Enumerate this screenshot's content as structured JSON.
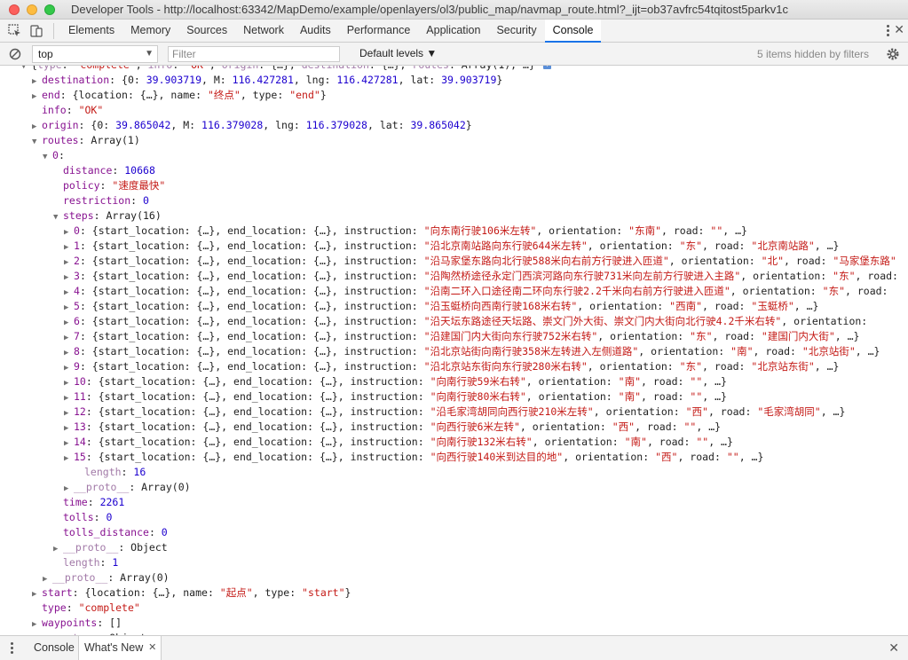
{
  "window": {
    "title": "Developer Tools - http://localhost:63342/MapDemo/example/openlayers/ol3/public_map/navmap_route.html?_ijt=ob37avfrc54tqitost5parkv1c"
  },
  "tabs": [
    "Elements",
    "Memory",
    "Sources",
    "Network",
    "Audits",
    "Performance",
    "Application",
    "Security",
    "Console"
  ],
  "active_tab": "Console",
  "console_toolbar": {
    "context": "top",
    "filter_placeholder": "Filter",
    "levels": "Default levels ▼",
    "hidden_msg": "5 items hidden by filters"
  },
  "lines": [
    {
      "indent": 1,
      "tri": "▼",
      "parts": [
        [
          "p",
          "{"
        ],
        [
          "k dim",
          "type"
        ],
        [
          "p",
          ": "
        ],
        [
          "s",
          "\"complete\""
        ],
        [
          "p",
          ", "
        ],
        [
          "k dim",
          "info"
        ],
        [
          "p",
          ": "
        ],
        [
          "s",
          "\"OK\""
        ],
        [
          "p",
          ", "
        ],
        [
          "k dim",
          "origin"
        ],
        [
          "p",
          ": {…}, "
        ],
        [
          "k dim",
          "destination"
        ],
        [
          "p",
          ": {…}, "
        ],
        [
          "k dim",
          "routes"
        ],
        [
          "p",
          ": Array(1), …} "
        ]
      ]
    },
    {
      "indent": 2,
      "tri": "▶",
      "parts": [
        [
          "k",
          "destination"
        ],
        [
          "p",
          ": {0: "
        ],
        [
          "n",
          "39.903719"
        ],
        [
          "p",
          ", M: "
        ],
        [
          "n",
          "116.427281"
        ],
        [
          "p",
          ", lng: "
        ],
        [
          "n",
          "116.427281"
        ],
        [
          "p",
          ", lat: "
        ],
        [
          "n",
          "39.903719"
        ],
        [
          "p",
          "}"
        ]
      ]
    },
    {
      "indent": 2,
      "tri": "▶",
      "parts": [
        [
          "k",
          "end"
        ],
        [
          "p",
          ": {location: {…}, name: "
        ],
        [
          "s",
          "\"终点\""
        ],
        [
          "p",
          ", type: "
        ],
        [
          "s",
          "\"end\""
        ],
        [
          "p",
          "}"
        ]
      ]
    },
    {
      "indent": 2,
      "tri": "",
      "parts": [
        [
          "k",
          "info"
        ],
        [
          "p",
          ": "
        ],
        [
          "s",
          "\"OK\""
        ]
      ]
    },
    {
      "indent": 2,
      "tri": "▶",
      "parts": [
        [
          "k",
          "origin"
        ],
        [
          "p",
          ": {0: "
        ],
        [
          "n",
          "39.865042"
        ],
        [
          "p",
          ", M: "
        ],
        [
          "n",
          "116.379028"
        ],
        [
          "p",
          ", lng: "
        ],
        [
          "n",
          "116.379028"
        ],
        [
          "p",
          ", lat: "
        ],
        [
          "n",
          "39.865042"
        ],
        [
          "p",
          "}"
        ]
      ]
    },
    {
      "indent": 2,
      "tri": "▼",
      "parts": [
        [
          "k",
          "routes"
        ],
        [
          "p",
          ": Array(1)"
        ]
      ]
    },
    {
      "indent": 3,
      "tri": "▼",
      "parts": [
        [
          "k",
          "0"
        ],
        [
          "p",
          ":"
        ]
      ]
    },
    {
      "indent": 4,
      "tri": "",
      "parts": [
        [
          "k",
          "distance"
        ],
        [
          "p",
          ": "
        ],
        [
          "n",
          "10668"
        ]
      ]
    },
    {
      "indent": 4,
      "tri": "",
      "parts": [
        [
          "k",
          "policy"
        ],
        [
          "p",
          ": "
        ],
        [
          "s",
          "\"速度最快\""
        ]
      ]
    },
    {
      "indent": 4,
      "tri": "",
      "parts": [
        [
          "k",
          "restriction"
        ],
        [
          "p",
          ": "
        ],
        [
          "n",
          "0"
        ]
      ]
    },
    {
      "indent": 4,
      "tri": "▼",
      "parts": [
        [
          "k",
          "steps"
        ],
        [
          "p",
          ": Array(16)"
        ]
      ]
    },
    {
      "indent": 5,
      "tri": "▶",
      "parts": [
        [
          "k",
          "0"
        ],
        [
          "p",
          ": {start_location: {…}, end_location: {…}, instruction: "
        ],
        [
          "s",
          "\"向东南行驶106米左转\""
        ],
        [
          "p",
          ", orientation: "
        ],
        [
          "s",
          "\"东南\""
        ],
        [
          "p",
          ", road: "
        ],
        [
          "s",
          "\"\""
        ],
        [
          "p",
          ", …}"
        ]
      ]
    },
    {
      "indent": 5,
      "tri": "▶",
      "parts": [
        [
          "k",
          "1"
        ],
        [
          "p",
          ": {start_location: {…}, end_location: {…}, instruction: "
        ],
        [
          "s",
          "\"沿北京南站路向东行驶644米左转\""
        ],
        [
          "p",
          ", orientation: "
        ],
        [
          "s",
          "\"东\""
        ],
        [
          "p",
          ", road: "
        ],
        [
          "s",
          "\"北京南站路\""
        ],
        [
          "p",
          ", …}"
        ]
      ]
    },
    {
      "indent": 5,
      "tri": "▶",
      "parts": [
        [
          "k",
          "2"
        ],
        [
          "p",
          ": {start_location: {…}, end_location: {…}, instruction: "
        ],
        [
          "s",
          "\"沿马家堡东路向北行驶588米向右前方行驶进入匝道\""
        ],
        [
          "p",
          ", orientation: "
        ],
        [
          "s",
          "\"北\""
        ],
        [
          "p",
          ", road: "
        ],
        [
          "s",
          "\"马家堡东路\""
        ]
      ]
    },
    {
      "indent": 5,
      "tri": "▶",
      "parts": [
        [
          "k",
          "3"
        ],
        [
          "p",
          ": {start_location: {…}, end_location: {…}, instruction: "
        ],
        [
          "s",
          "\"沿陶然桥途径永定门西滨河路向东行驶731米向左前方行驶进入主路\""
        ],
        [
          "p",
          ", orientation: "
        ],
        [
          "s",
          "\"东\""
        ],
        [
          "p",
          ", road: "
        ]
      ]
    },
    {
      "indent": 5,
      "tri": "▶",
      "parts": [
        [
          "k",
          "4"
        ],
        [
          "p",
          ": {start_location: {…}, end_location: {…}, instruction: "
        ],
        [
          "s",
          "\"沿南二环入口途径南二环向东行驶2.2千米向右前方行驶进入匝道\""
        ],
        [
          "p",
          ", orientation: "
        ],
        [
          "s",
          "\"东\""
        ],
        [
          "p",
          ", road: "
        ]
      ]
    },
    {
      "indent": 5,
      "tri": "▶",
      "parts": [
        [
          "k",
          "5"
        ],
        [
          "p",
          ": {start_location: {…}, end_location: {…}, instruction: "
        ],
        [
          "s",
          "\"沿玉蜓桥向西南行驶168米右转\""
        ],
        [
          "p",
          ", orientation: "
        ],
        [
          "s",
          "\"西南\""
        ],
        [
          "p",
          ", road: "
        ],
        [
          "s",
          "\"玉蜓桥\""
        ],
        [
          "p",
          ", …}"
        ]
      ]
    },
    {
      "indent": 5,
      "tri": "▶",
      "parts": [
        [
          "k",
          "6"
        ],
        [
          "p",
          ": {start_location: {…}, end_location: {…}, instruction: "
        ],
        [
          "s",
          "\"沿天坛东路途径天坛路、崇文门外大街、崇文门内大街向北行驶4.2千米右转\""
        ],
        [
          "p",
          ", orientation: "
        ]
      ]
    },
    {
      "indent": 5,
      "tri": "▶",
      "parts": [
        [
          "k",
          "7"
        ],
        [
          "p",
          ": {start_location: {…}, end_location: {…}, instruction: "
        ],
        [
          "s",
          "\"沿建国门内大街向东行驶752米右转\""
        ],
        [
          "p",
          ", orientation: "
        ],
        [
          "s",
          "\"东\""
        ],
        [
          "p",
          ", road: "
        ],
        [
          "s",
          "\"建国门内大街\""
        ],
        [
          "p",
          ", …}"
        ]
      ]
    },
    {
      "indent": 5,
      "tri": "▶",
      "parts": [
        [
          "k",
          "8"
        ],
        [
          "p",
          ": {start_location: {…}, end_location: {…}, instruction: "
        ],
        [
          "s",
          "\"沿北京站街向南行驶358米左转进入左侧道路\""
        ],
        [
          "p",
          ", orientation: "
        ],
        [
          "s",
          "\"南\""
        ],
        [
          "p",
          ", road: "
        ],
        [
          "s",
          "\"北京站街\""
        ],
        [
          "p",
          ", …}"
        ]
      ]
    },
    {
      "indent": 5,
      "tri": "▶",
      "parts": [
        [
          "k",
          "9"
        ],
        [
          "p",
          ": {start_location: {…}, end_location: {…}, instruction: "
        ],
        [
          "s",
          "\"沿北京站东街向东行驶280米右转\""
        ],
        [
          "p",
          ", orientation: "
        ],
        [
          "s",
          "\"东\""
        ],
        [
          "p",
          ", road: "
        ],
        [
          "s",
          "\"北京站东街\""
        ],
        [
          "p",
          ", …}"
        ]
      ]
    },
    {
      "indent": 5,
      "tri": "▶",
      "parts": [
        [
          "k",
          "10"
        ],
        [
          "p",
          ": {start_location: {…}, end_location: {…}, instruction: "
        ],
        [
          "s",
          "\"向南行驶59米右转\""
        ],
        [
          "p",
          ", orientation: "
        ],
        [
          "s",
          "\"南\""
        ],
        [
          "p",
          ", road: "
        ],
        [
          "s",
          "\"\""
        ],
        [
          "p",
          ", …}"
        ]
      ]
    },
    {
      "indent": 5,
      "tri": "▶",
      "parts": [
        [
          "k",
          "11"
        ],
        [
          "p",
          ": {start_location: {…}, end_location: {…}, instruction: "
        ],
        [
          "s",
          "\"向南行驶80米右转\""
        ],
        [
          "p",
          ", orientation: "
        ],
        [
          "s",
          "\"南\""
        ],
        [
          "p",
          ", road: "
        ],
        [
          "s",
          "\"\""
        ],
        [
          "p",
          ", …}"
        ]
      ]
    },
    {
      "indent": 5,
      "tri": "▶",
      "parts": [
        [
          "k",
          "12"
        ],
        [
          "p",
          ": {start_location: {…}, end_location: {…}, instruction: "
        ],
        [
          "s",
          "\"沿毛家湾胡同向西行驶210米左转\""
        ],
        [
          "p",
          ", orientation: "
        ],
        [
          "s",
          "\"西\""
        ],
        [
          "p",
          ", road: "
        ],
        [
          "s",
          "\"毛家湾胡同\""
        ],
        [
          "p",
          ", …}"
        ]
      ]
    },
    {
      "indent": 5,
      "tri": "▶",
      "parts": [
        [
          "k",
          "13"
        ],
        [
          "p",
          ": {start_location: {…}, end_location: {…}, instruction: "
        ],
        [
          "s",
          "\"向西行驶6米左转\""
        ],
        [
          "p",
          ", orientation: "
        ],
        [
          "s",
          "\"西\""
        ],
        [
          "p",
          ", road: "
        ],
        [
          "s",
          "\"\""
        ],
        [
          "p",
          ", …}"
        ]
      ]
    },
    {
      "indent": 5,
      "tri": "▶",
      "parts": [
        [
          "k",
          "14"
        ],
        [
          "p",
          ": {start_location: {…}, end_location: {…}, instruction: "
        ],
        [
          "s",
          "\"向南行驶132米右转\""
        ],
        [
          "p",
          ", orientation: "
        ],
        [
          "s",
          "\"南\""
        ],
        [
          "p",
          ", road: "
        ],
        [
          "s",
          "\"\""
        ],
        [
          "p",
          ", …}"
        ]
      ]
    },
    {
      "indent": 5,
      "tri": "▶",
      "parts": [
        [
          "k",
          "15"
        ],
        [
          "p",
          ": {start_location: {…}, end_location: {…}, instruction: "
        ],
        [
          "s",
          "\"向西行驶140米到达目的地\""
        ],
        [
          "p",
          ", orientation: "
        ],
        [
          "s",
          "\"西\""
        ],
        [
          "p",
          ", road: "
        ],
        [
          "s",
          "\"\""
        ],
        [
          "p",
          ", …}"
        ]
      ]
    },
    {
      "indent": 6,
      "tri": "",
      "parts": [
        [
          "k dim",
          "length"
        ],
        [
          "p",
          ": "
        ],
        [
          "n",
          "16"
        ]
      ]
    },
    {
      "indent": 5,
      "tri": "▶",
      "parts": [
        [
          "k dim",
          "__proto__"
        ],
        [
          "p",
          ": Array(0)"
        ]
      ]
    },
    {
      "indent": 4,
      "tri": "",
      "parts": [
        [
          "k",
          "time"
        ],
        [
          "p",
          ": "
        ],
        [
          "n",
          "2261"
        ]
      ]
    },
    {
      "indent": 4,
      "tri": "",
      "parts": [
        [
          "k",
          "tolls"
        ],
        [
          "p",
          ": "
        ],
        [
          "n",
          "0"
        ]
      ]
    },
    {
      "indent": 4,
      "tri": "",
      "parts": [
        [
          "k",
          "tolls_distance"
        ],
        [
          "p",
          ": "
        ],
        [
          "n",
          "0"
        ]
      ]
    },
    {
      "indent": 4,
      "tri": "▶",
      "parts": [
        [
          "k dim",
          "__proto__"
        ],
        [
          "p",
          ": Object"
        ]
      ]
    },
    {
      "indent": 4,
      "tri": "",
      "parts": [
        [
          "k dim",
          "length"
        ],
        [
          "p",
          ": "
        ],
        [
          "n",
          "1"
        ]
      ]
    },
    {
      "indent": 3,
      "tri": "▶",
      "parts": [
        [
          "k dim",
          "__proto__"
        ],
        [
          "p",
          ": Array(0)"
        ]
      ]
    },
    {
      "indent": 2,
      "tri": "▶",
      "parts": [
        [
          "k",
          "start"
        ],
        [
          "p",
          ": {location: {…}, name: "
        ],
        [
          "s",
          "\"起点\""
        ],
        [
          "p",
          ", type: "
        ],
        [
          "s",
          "\"start\""
        ],
        [
          "p",
          "}"
        ]
      ]
    },
    {
      "indent": 2,
      "tri": "",
      "parts": [
        [
          "k",
          "type"
        ],
        [
          "p",
          ": "
        ],
        [
          "s",
          "\"complete\""
        ]
      ]
    },
    {
      "indent": 2,
      "tri": "▶",
      "parts": [
        [
          "k",
          "waypoints"
        ],
        [
          "p",
          ": []"
        ]
      ]
    },
    {
      "indent": 2,
      "tri": "▶",
      "parts": [
        [
          "k dim",
          "__proto__"
        ],
        [
          "p",
          ": Object"
        ]
      ]
    }
  ],
  "drawer": {
    "tabs": [
      "Console",
      "What's New"
    ],
    "active": "What's New"
  }
}
